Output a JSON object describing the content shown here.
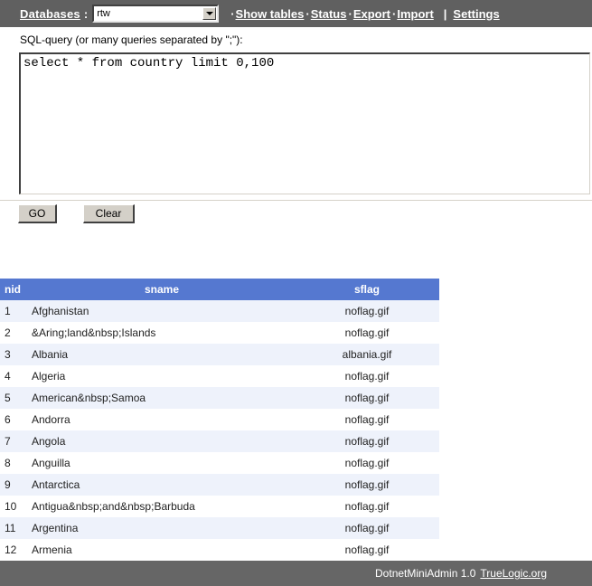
{
  "header": {
    "databases_label": "Databases",
    "colon": ":",
    "selected_database": "rtw",
    "dropdown_icon": "chevron-down-icon",
    "nav": [
      {
        "dot": "·",
        "label": "Show tables"
      },
      {
        "dot": "·",
        "label": "Status"
      },
      {
        "dot": "·",
        "label": "Export"
      },
      {
        "dot": "·",
        "label": "Import"
      }
    ],
    "nav_separator": "|",
    "settings_label": "Settings",
    "bar_color": "#606060"
  },
  "query": {
    "label": "SQL-query (or many queries separated by \";\"):",
    "value": "select * from country limit 0,100",
    "placeholder": ""
  },
  "buttons": {
    "go_label": "GO",
    "clear_label": "Clear"
  },
  "results": {
    "columns": [
      "nid",
      "sname",
      "sflag"
    ],
    "header_color": "#5578d0",
    "stripe_color": "#eef2fb",
    "rows": [
      {
        "nid": "1",
        "sname": "Afghanistan",
        "sflag": "noflag.gif"
      },
      {
        "nid": "2",
        "sname": "&Aring;land&nbsp;Islands",
        "sflag": "noflag.gif"
      },
      {
        "nid": "3",
        "sname": "Albania",
        "sflag": "albania.gif"
      },
      {
        "nid": "4",
        "sname": "Algeria",
        "sflag": "noflag.gif"
      },
      {
        "nid": "5",
        "sname": "American&nbsp;Samoa",
        "sflag": "noflag.gif"
      },
      {
        "nid": "6",
        "sname": "Andorra",
        "sflag": "noflag.gif"
      },
      {
        "nid": "7",
        "sname": "Angola",
        "sflag": "noflag.gif"
      },
      {
        "nid": "8",
        "sname": "Anguilla",
        "sflag": "noflag.gif"
      },
      {
        "nid": "9",
        "sname": "Antarctica",
        "sflag": "noflag.gif"
      },
      {
        "nid": "10",
        "sname": "Antigua&nbsp;and&nbsp;Barbuda",
        "sflag": "noflag.gif"
      },
      {
        "nid": "11",
        "sname": "Argentina",
        "sflag": "noflag.gif"
      },
      {
        "nid": "12",
        "sname": "Armenia",
        "sflag": "noflag.gif"
      }
    ]
  },
  "footer": {
    "app_name": "DotnetMiniAdmin 1.0",
    "link_label": "TrueLogic.org",
    "bar_color": "#666666"
  }
}
